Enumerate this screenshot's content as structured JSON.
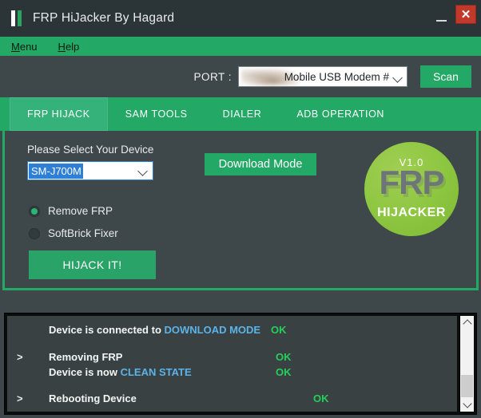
{
  "window": {
    "title": "FRP HiJacker By Hagard",
    "icon_name": "app-bars-icon",
    "minimize_label": "",
    "close_label": "✕"
  },
  "menubar": {
    "items": [
      {
        "label": "Menu",
        "accel": "M"
      },
      {
        "label": "Help",
        "accel": "H"
      }
    ]
  },
  "port": {
    "label": "PORT :",
    "value": "Mobile USB Modem #",
    "placeholder": "Mobile USB Modem #",
    "scan_label": "Scan"
  },
  "tabs": [
    {
      "label": "FRP HIJACK",
      "active": true
    },
    {
      "label": "SAM TOOLS",
      "active": false
    },
    {
      "label": "DIALER",
      "active": false
    },
    {
      "label": "ADB OPERATION",
      "active": false
    }
  ],
  "frp_hijack": {
    "device_label": "Please Select Your Device",
    "device_value": "SM-J700M",
    "download_mode_label": "Download Mode",
    "options": [
      {
        "label": "Remove FRP",
        "selected": true
      },
      {
        "label": "SoftBrick Fixer",
        "selected": false
      }
    ],
    "hijack_label": "HIJACK IT!"
  },
  "logo": {
    "version": "V1.0",
    "main": "FRP",
    "sub": "HIJACKER",
    "color": "#8cc63f"
  },
  "log": {
    "lines": [
      {
        "prompt": "",
        "text_a": "Device is connected to ",
        "highlight": "DOWNLOAD MODE",
        "text_b": "",
        "status": "OK"
      },
      {
        "prompt": ">",
        "text_a": "Removing FRP",
        "highlight": "",
        "text_b": "",
        "status": "OK"
      },
      {
        "prompt": "",
        "text_a": "Device is now ",
        "highlight": "CLEAN STATE",
        "text_b": "",
        "status": "OK"
      },
      {
        "prompt": ">",
        "text_a": "Rebooting Device",
        "highlight": "",
        "text_b": "",
        "status": "OK"
      }
    ],
    "status_ok": "OK",
    "prompt_glyph": ">"
  },
  "colors": {
    "accent_green": "#23a865",
    "tab_active": "#35b27a",
    "dark_panel": "#3e484b",
    "titlebar": "#2b3437",
    "ok_green": "#24cf5a",
    "highlight_blue": "#5bb3e8",
    "close_red": "#c0392b"
  }
}
